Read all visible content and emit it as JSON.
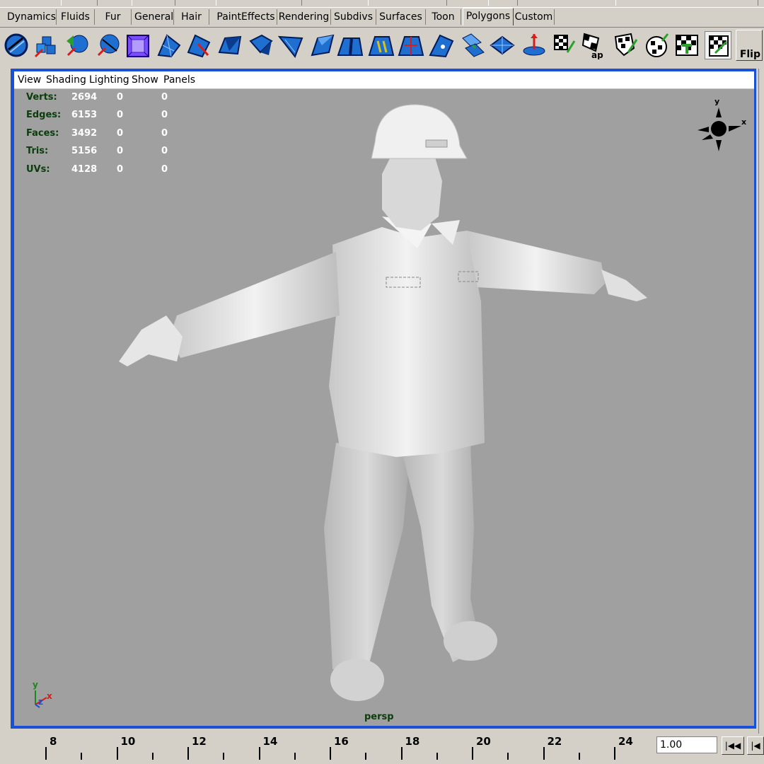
{
  "shelf_tabs": [
    "Dynamics",
    "Fluids",
    "Fur",
    "General",
    "Hair",
    "PaintEffects",
    "Rendering",
    "Subdivs",
    "Surfaces",
    "Toon",
    "Polygons",
    "Custom"
  ],
  "active_tab": "Polygons",
  "shelf": {
    "icons": [
      "polygon-sphere-icon",
      "polygon-cube-icon",
      "polygon-cylinder-icon",
      "polygon-cone-icon",
      "polygon-torus-icon",
      "polygon-plane-icon",
      "append-polygon-icon",
      "split-polygon-icon",
      "extrude-face-icon",
      "extrude-edge-icon",
      "bevel-icon",
      "wedge-face-icon",
      "poke-face-icon",
      "merge-vertices-icon",
      "collapse-icon",
      "subdivide-icon",
      "duplicate-face-icon",
      "extract-icon",
      "smooth-icon",
      "planar-mapping-icon",
      "cylindrical-mapping-icon",
      "spherical-mapping-icon",
      "automatic-mapping-icon",
      "uv-layout-icon",
      "cut-uvs-icon",
      "sew-uvs-icon",
      "uv-texture-editor-icon"
    ],
    "flip_label": "Flip",
    "map_label": "ap"
  },
  "panel_menu": [
    "View",
    "Shading",
    "Lighting",
    "Show",
    "Panels"
  ],
  "hud": [
    {
      "label": "Verts:",
      "total": "2694",
      "sel": "0",
      "comp": "0"
    },
    {
      "label": "Edges:",
      "total": "6153",
      "sel": "0",
      "comp": "0"
    },
    {
      "label": "Faces:",
      "total": "3492",
      "sel": "0",
      "comp": "0"
    },
    {
      "label": "Tris:",
      "total": "5156",
      "sel": "0",
      "comp": "0"
    },
    {
      "label": "UVs:",
      "total": "4128",
      "sel": "0",
      "comp": "0"
    }
  ],
  "view_cube": {
    "y": "y",
    "x": "x"
  },
  "axis_gizmo": {
    "y": "y",
    "z": "z",
    "x": "x"
  },
  "camera_label": "persp",
  "timeline": {
    "major_ticks": [
      "8",
      "10",
      "12",
      "14",
      "16",
      "18",
      "20",
      "22",
      "24"
    ],
    "current_time": "1.00"
  },
  "colors": {
    "viewport_bg": "#a0a0a0",
    "panel_highlight": "#1a4fd8",
    "hud_label": "#0b3d0b",
    "hud_value": "#ffffff"
  }
}
